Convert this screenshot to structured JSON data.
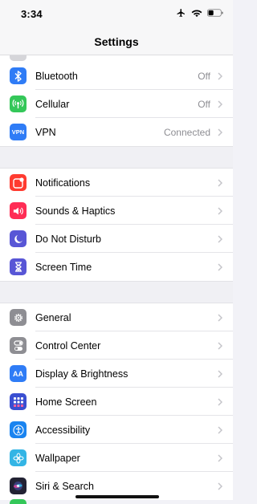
{
  "status": {
    "time": "3:34"
  },
  "nav": {
    "title": "Settings"
  },
  "group1": [
    {
      "label": "Bluetooth",
      "value": "Off",
      "icon": "bluetooth-icon",
      "color": "#2f7cf6"
    },
    {
      "label": "Cellular",
      "value": "Off",
      "icon": "cellular-icon",
      "color": "#34c759"
    },
    {
      "label": "VPN",
      "value": "Connected",
      "icon": "vpn-icon",
      "color": "#2f7cf6",
      "icon_text": "VPN"
    }
  ],
  "group2": [
    {
      "label": "Notifications",
      "icon": "notifications-icon",
      "color": "#ff3b30"
    },
    {
      "label": "Sounds & Haptics",
      "icon": "speaker-icon",
      "color": "#ff2d55"
    },
    {
      "label": "Do Not Disturb",
      "icon": "moon-icon",
      "color": "#5856d6"
    },
    {
      "label": "Screen Time",
      "icon": "hourglass-icon",
      "color": "#5856d6"
    }
  ],
  "group3": [
    {
      "label": "General",
      "icon": "gear-icon",
      "color": "#8e8e93"
    },
    {
      "label": "Control Center",
      "icon": "toggles-icon",
      "color": "#8e8e93"
    },
    {
      "label": "Display & Brightness",
      "icon": "text-size-icon",
      "color": "#2f7cf6",
      "icon_text": "AA"
    },
    {
      "label": "Home Screen",
      "icon": "app-grid-icon",
      "color": "#3a4fd1"
    },
    {
      "label": "Accessibility",
      "icon": "accessibility-icon",
      "color": "#1a84f0"
    },
    {
      "label": "Wallpaper",
      "icon": "flower-icon",
      "color": "#33b5e5"
    },
    {
      "label": "Siri & Search",
      "icon": "siri-icon",
      "color": "#222233"
    }
  ]
}
